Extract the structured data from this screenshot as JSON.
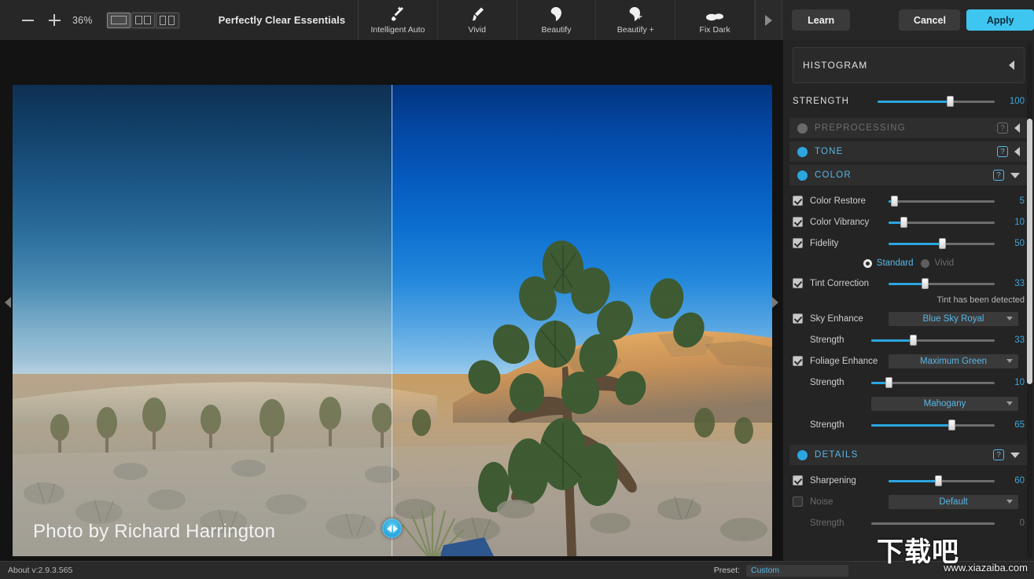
{
  "toolbar": {
    "zoom_out_icon": "minus-icon",
    "zoom_in_icon": "plus-icon",
    "zoom_level": "36%",
    "view_modes": [
      {
        "name": "single-view",
        "icon": "single-pane-icon",
        "active": true
      },
      {
        "name": "split-view",
        "icon": "split-pane-icon",
        "active": false
      },
      {
        "name": "side-by-side-view",
        "icon": "book-pane-icon",
        "active": false
      }
    ],
    "preset_group": "Perfectly Clear Essentials",
    "preset_group_chevron": "chevron-down-icon",
    "presets": [
      {
        "label": "Intelligent Auto",
        "icon": "magic-wand-icon"
      },
      {
        "label": "Vivid",
        "icon": "brush-icon"
      },
      {
        "label": "Beautify",
        "icon": "face-icon"
      },
      {
        "label": "Beautify +",
        "icon": "face-plus-icon"
      },
      {
        "label": "Fix Dark",
        "icon": "cloud-icon"
      }
    ],
    "strip_scroll_icon": "chevron-right-icon",
    "learn_label": "Learn",
    "cancel_label": "Cancel",
    "apply_label": "Apply",
    "apply_color": "#3ec6f0"
  },
  "canvas": {
    "prev_image_icon": "chevron-left-icon",
    "next_image_icon": "chevron-right-icon",
    "split_handle_icon": "split-drag-handle-icon",
    "credit": "Photo by Richard Harrington"
  },
  "panel": {
    "histogram": {
      "title": "HISTOGRAM",
      "collapse_icon": "caret-left-icon"
    },
    "strength": {
      "label": "STRENGTH",
      "value": "100",
      "percent": 100
    },
    "sections": [
      {
        "key": "preprocessing",
        "title": "PREPROCESSING",
        "enabled": false,
        "expanded": false,
        "help_icon": "question-mark-icon",
        "toggle_icon": "caret-left-icon"
      },
      {
        "key": "tone",
        "title": "TONE",
        "enabled": true,
        "expanded": false,
        "help_icon": "question-mark-icon",
        "toggle_icon": "caret-left-icon"
      },
      {
        "key": "color",
        "title": "COLOR",
        "enabled": true,
        "expanded": true,
        "help_icon": "question-mark-icon",
        "toggle_icon": "caret-down-icon"
      },
      {
        "key": "details",
        "title": "DETAILS",
        "enabled": true,
        "expanded": true,
        "help_icon": "question-mark-icon",
        "toggle_icon": "caret-down-icon"
      }
    ],
    "color_controls": {
      "color_restore": {
        "label": "Color Restore",
        "checked": true,
        "value": "5",
        "percent": 5
      },
      "color_vibrancy": {
        "label": "Color Vibrancy",
        "checked": true,
        "value": "10",
        "percent": 10
      },
      "fidelity": {
        "label": "Fidelity",
        "checked": true,
        "value": "50",
        "percent": 50
      },
      "fidelity_mode": {
        "options": [
          {
            "label": "Standard",
            "selected": true
          },
          {
            "label": "Vivid",
            "selected": false
          }
        ]
      },
      "tint_correction": {
        "label": "Tint Correction",
        "checked": true,
        "value": "33",
        "percent": 33
      },
      "tint_note": "Tint has been detected",
      "sky_enhance": {
        "label": "Sky Enhance",
        "checked": true,
        "preset": "Blue Sky Royal",
        "dropdown_icon": "caret-down-icon",
        "strength_label": "Strength",
        "strength_value": "33",
        "strength_percent": 33
      },
      "foliage_enhance": {
        "label": "Foliage Enhance",
        "checked": true,
        "preset": "Maximum Green",
        "dropdown_icon": "caret-down-icon",
        "strength_label": "Strength",
        "strength_value": "10",
        "strength_percent": 10
      },
      "skin_tone": {
        "preset": "Mahogany",
        "dropdown_icon": "caret-down-icon",
        "strength_label": "Strength",
        "strength_value": "65",
        "strength_percent": 65
      }
    },
    "details_controls": {
      "sharpening": {
        "label": "Sharpening",
        "checked": true,
        "value": "60",
        "percent": 60
      },
      "noise": {
        "label": "Noise",
        "checked": false,
        "preset": "Default",
        "dropdown_icon": "caret-down-icon"
      },
      "noise_strength": {
        "label": "Strength",
        "value": "0",
        "percent": 0
      }
    },
    "scrollbar_icon": "vertical-scrollbar"
  },
  "statusbar": {
    "about": "About v:2.9.3.565",
    "preset_key": "Preset:",
    "preset_value": "Custom"
  },
  "watermark": {
    "cn_text": "下载吧",
    "url_text": "www.xiazaiba.com"
  }
}
